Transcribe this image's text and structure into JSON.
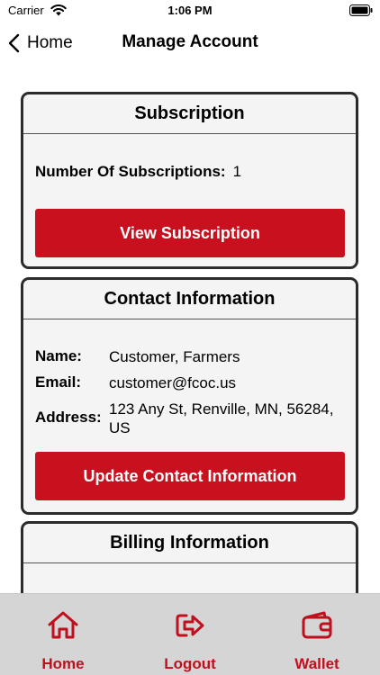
{
  "status_bar": {
    "carrier": "Carrier",
    "time": "1:06 PM"
  },
  "nav": {
    "back_label": "Home",
    "title": "Manage Account"
  },
  "subscription": {
    "title": "Subscription",
    "count_label": "Number Of Subscriptions:",
    "count_value": "1",
    "button_label": "View Subscription"
  },
  "contact": {
    "title": "Contact Information",
    "name_label": "Name:",
    "name_value": "Customer, Farmers",
    "email_label": "Email:",
    "email_value": "customer@fcoc.us",
    "address_label": "Address:",
    "address_value": "123 Any St, Renville, MN, 56284, US",
    "button_label": "Update Contact Information"
  },
  "billing": {
    "title": "Billing Information"
  },
  "tab_bar": {
    "items": [
      {
        "label": "Home",
        "icon": "home-icon"
      },
      {
        "label": "Logout",
        "icon": "logout-icon"
      },
      {
        "label": "Wallet",
        "icon": "wallet-icon"
      }
    ]
  },
  "colors": {
    "accent": "#c8101e",
    "card_bg": "#f4f4f4",
    "card_border": "#2b2b2b",
    "tab_bar_bg": "#d5d5d5"
  }
}
